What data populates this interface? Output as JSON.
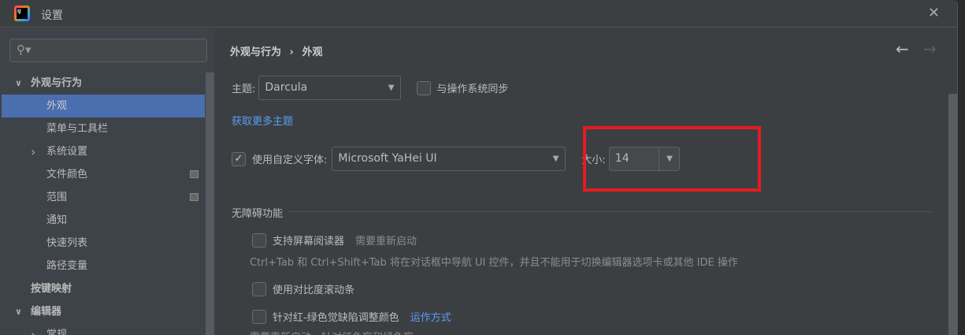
{
  "window": {
    "title": "设置",
    "close_icon": "close-icon"
  },
  "sidebar": {
    "search": {
      "placeholder": "",
      "value": ""
    },
    "items": [
      {
        "label": "外观与行为",
        "level": 0,
        "expanded": true,
        "bold": true
      },
      {
        "label": "外观",
        "level": 1,
        "selected": true
      },
      {
        "label": "菜单与工具栏",
        "level": 1
      },
      {
        "label": "系统设置",
        "level": 1,
        "collapsed": true
      },
      {
        "label": "文件颜色",
        "level": 1,
        "badge": true
      },
      {
        "label": "范围",
        "level": 1,
        "badge": true
      },
      {
        "label": "通知",
        "level": 1
      },
      {
        "label": "快速列表",
        "level": 1
      },
      {
        "label": "路径变量",
        "level": 1
      },
      {
        "label": "按键映射",
        "level": 0,
        "bold": true
      },
      {
        "label": "编辑器",
        "level": 0,
        "expanded": true,
        "bold": true
      },
      {
        "label": "常规",
        "level": 1,
        "collapsed": true
      }
    ]
  },
  "main": {
    "breadcrumb": {
      "parent": "外观与行为",
      "separator": "›",
      "current": "外观"
    },
    "theme": {
      "label": "主题:",
      "value": "Darcula",
      "sync_label": "与操作系统同步",
      "sync_checked": false
    },
    "get_more_themes": "获取更多主题",
    "custom_font": {
      "checked": true,
      "label": "使用自定义字体:",
      "value": "Microsoft YaHei UI",
      "size_label": "大小:",
      "size_value": "14"
    },
    "accessibility": {
      "section_title": "无障碍功能",
      "screen_reader": {
        "label": "支持屏幕阅读器",
        "note": "需要重新启动",
        "checked": false,
        "description": "Ctrl+Tab 和 Ctrl+Shift+Tab 将在对话框中导航 UI 控件，并且不能用于切换编辑器选项卡或其他 IDE 操作"
      },
      "contrast_scrollbars": {
        "label": "使用对比度滚动条",
        "checked": false
      },
      "color_deficiency": {
        "label": "针对红-绿色觉缺陷调整颜色",
        "link": "运作方式",
        "checked": false,
        "description": "需要重新启动。针对红色盲和绿色盲"
      }
    }
  },
  "colors": {
    "accent": "#4b6eaf",
    "link": "#589df6",
    "highlight": "#e51b23"
  }
}
